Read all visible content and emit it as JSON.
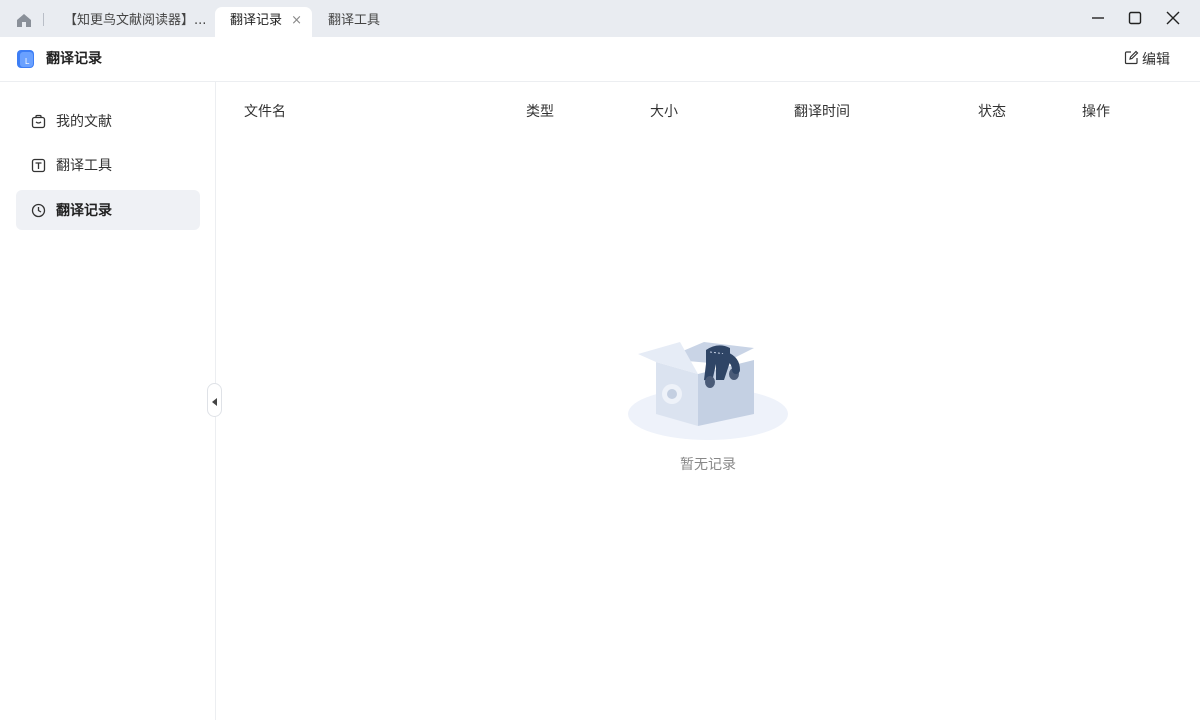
{
  "tabs": [
    {
      "label": "【知更鸟文献阅读器】..."
    },
    {
      "label": "翻译记录",
      "close": "×"
    },
    {
      "label": "翻译工具"
    }
  ],
  "header": {
    "title": "翻译记录",
    "edit_label": "编辑"
  },
  "sidebar": {
    "items": [
      {
        "label": "我的文献",
        "icon": "bag-icon"
      },
      {
        "label": "翻译工具",
        "icon": "translate-icon"
      },
      {
        "label": "翻译记录",
        "icon": "clock-icon",
        "active": true
      }
    ]
  },
  "table": {
    "columns": [
      "文件名",
      "类型",
      "大小",
      "翻译时间",
      "状态",
      "操作"
    ],
    "empty_text": "暂无记录"
  },
  "colors": {
    "tabbar_bg": "#e9ecf1",
    "active_nav_bg": "#eff1f5",
    "logo_blue": "#3d7ef5"
  }
}
